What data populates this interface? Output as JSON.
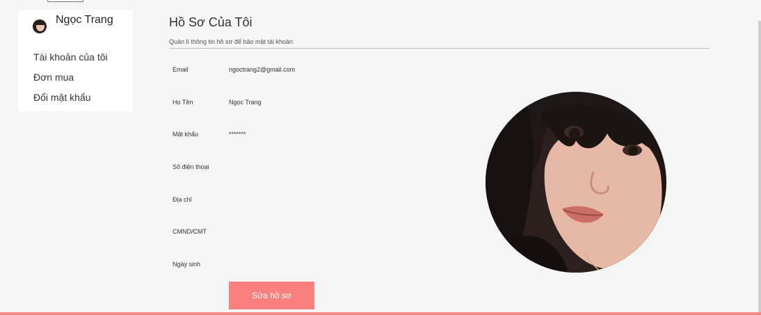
{
  "sidebar": {
    "username": "Ngọc Trang",
    "menu": [
      {
        "label": "Tài khoản của tôi"
      },
      {
        "label": "Đơn mua"
      },
      {
        "label": "Đổi mật khẩu"
      }
    ]
  },
  "profile": {
    "title": "Hồ Sơ Của Tôi",
    "subtitle": "Quản lí thông tin hồ sơ để bảo mật tài khoản",
    "fields": [
      {
        "label": "Email",
        "value": "ngoctrang2@gmail.com"
      },
      {
        "label": "Họ Tên",
        "value": "Ngọc Trang"
      },
      {
        "label": "Mật khẩu",
        "value": "*******"
      },
      {
        "label": "Số điện thoại",
        "value": ""
      },
      {
        "label": "Địa chỉ",
        "value": ""
      },
      {
        "label": "CMND/CMT",
        "value": ""
      },
      {
        "label": "Ngày sinh",
        "value": ""
      }
    ],
    "edit_button": "Sửa hồ sơ"
  },
  "theme": {
    "accent": "#fa8080",
    "background": "#f5f5f5",
    "panel": "#ffffff"
  },
  "icons": {
    "avatar": "user-avatar-photo"
  }
}
